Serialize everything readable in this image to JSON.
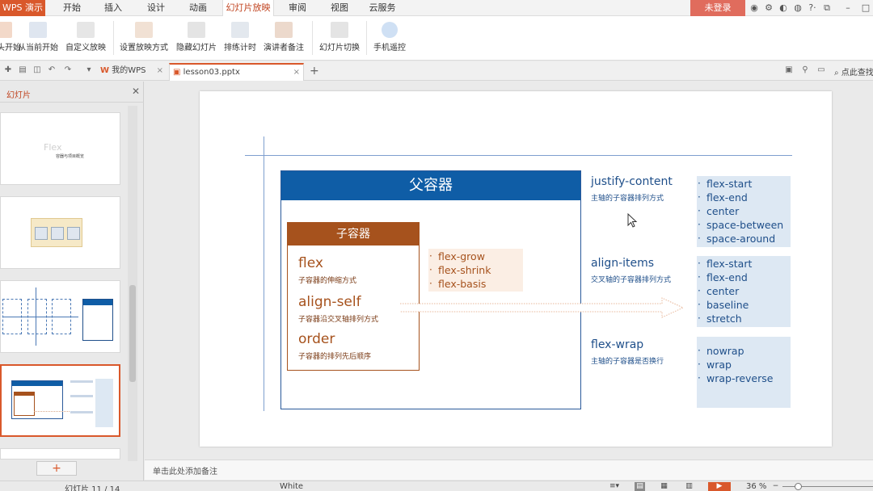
{
  "app": {
    "name": "WPS 演示"
  },
  "menu": {
    "items": [
      "开始",
      "插入",
      "设计",
      "动画",
      "幻灯片放映",
      "审阅",
      "视图",
      "云服务"
    ],
    "active": "幻灯片放映",
    "login_label": "未登录"
  },
  "ribbon": {
    "buttons": [
      {
        "label": "从头开始"
      },
      {
        "label": "从当前开始"
      },
      {
        "label": "自定义放映"
      },
      {
        "label": "设置放映方式"
      },
      {
        "label": "隐藏幻灯片"
      },
      {
        "label": "排练计时"
      },
      {
        "label": "演讲者备注"
      },
      {
        "label": "幻灯片切换"
      },
      {
        "label": "手机遥控"
      }
    ]
  },
  "tabs": {
    "items": [
      {
        "label": "我的WPS"
      },
      {
        "label": "lesson03.pptx"
      }
    ],
    "search_label": "点此查找"
  },
  "left_panel": {
    "title": "幻灯片",
    "thumb1_text": "Flex",
    "thumb1_sub": "容器与项目概览"
  },
  "slide": {
    "parent_title": "父容器",
    "child_title": "子容器",
    "child_props": [
      {
        "name": "flex",
        "desc": "子容器的伸缩方式"
      },
      {
        "name": "align-self",
        "desc": "子容器沿交叉轴排列方式"
      },
      {
        "name": "order",
        "desc": "子容器的排列先后顺序"
      }
    ],
    "flex_values": [
      "flex-grow",
      "flex-shrink",
      "flex-basis"
    ],
    "parent_props": [
      {
        "name": "justify-content",
        "desc": "主轴的子容器排列方式",
        "values": [
          "flex-start",
          "flex-end",
          "center",
          "space-between",
          "space-around"
        ]
      },
      {
        "name": "align-items",
        "desc": "交叉轴的子容器排列方式",
        "values": [
          "flex-start",
          "flex-end",
          "center",
          "baseline",
          "stretch"
        ]
      },
      {
        "name": "flex-wrap",
        "desc": "主轴的子容器是否换行",
        "values": [
          "nowrap",
          "wrap",
          "wrap-reverse"
        ]
      }
    ]
  },
  "notes": {
    "placeholder": "单击此处添加备注"
  },
  "status": {
    "slide_counter": "幻灯片 11 / 14",
    "theme": "White",
    "zoom": "36 %"
  },
  "colors": {
    "accent": "#d9582b",
    "parent_blue": "#0f5da6",
    "child_brown": "#a6521d"
  }
}
